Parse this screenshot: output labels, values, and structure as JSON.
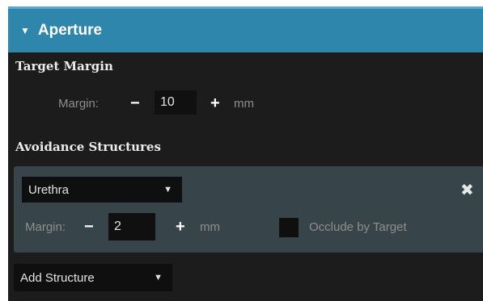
{
  "header": {
    "title": "Aperture",
    "arrow": "▼"
  },
  "target_margin": {
    "section_title": "Target Margin",
    "label": "Margin:",
    "minus": "−",
    "value": "10",
    "plus": "+",
    "unit": "mm"
  },
  "avoidance": {
    "section_title": "Avoidance Structures",
    "structures": [
      {
        "name": "Urethra",
        "remove": "✖",
        "label": "Margin:",
        "minus": "−",
        "value": "2",
        "plus": "+",
        "unit": "mm",
        "occlude_label": "Occlude by Target",
        "occlude_checked": false
      }
    ],
    "add_label": "Add Structure",
    "dropdown_arrow": "▼"
  }
}
